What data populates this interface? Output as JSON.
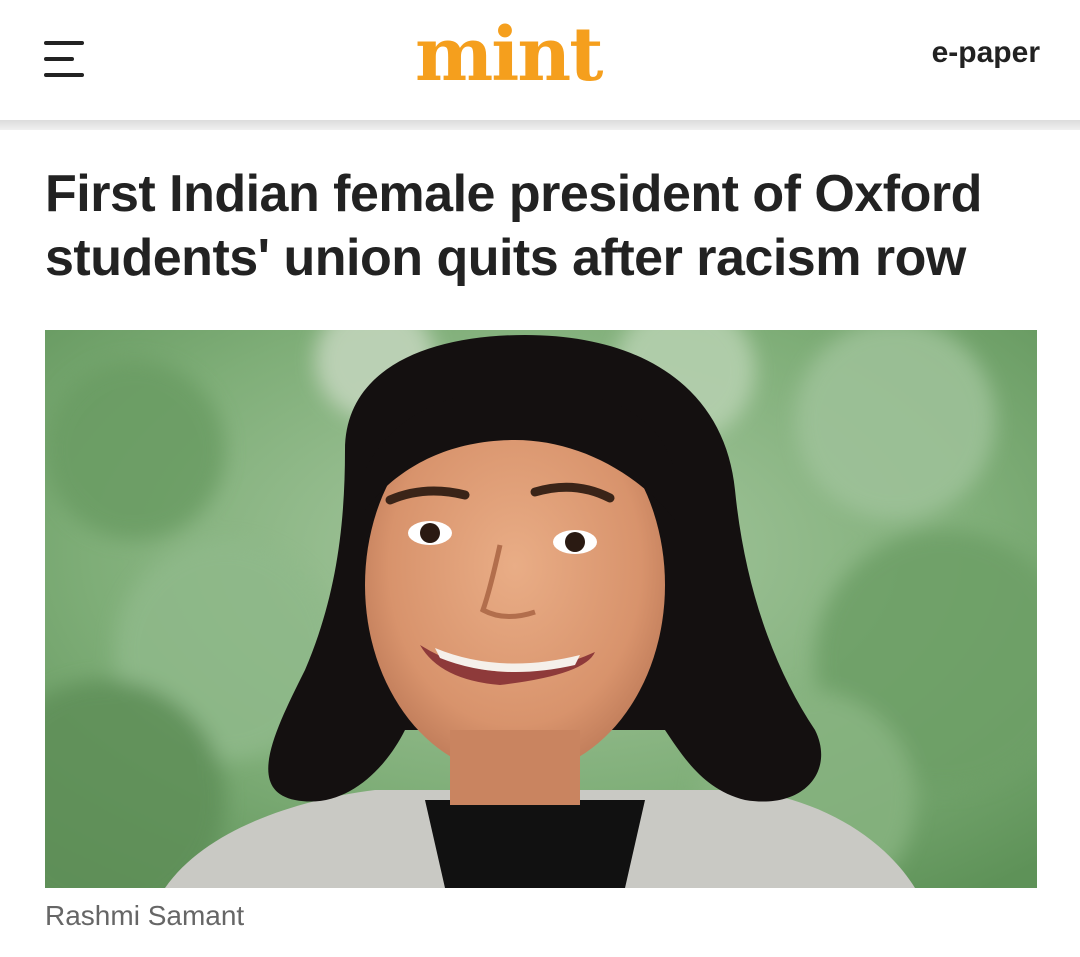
{
  "header": {
    "logo_text": "mint",
    "epaper_label": "e-paper",
    "logo_color": "#f59f1d"
  },
  "article": {
    "headline": "First Indian female president of Oxford students' union quits after racism row",
    "image_caption": "Rashmi Samant"
  },
  "icons": {
    "menu": "hamburger-menu-icon"
  }
}
